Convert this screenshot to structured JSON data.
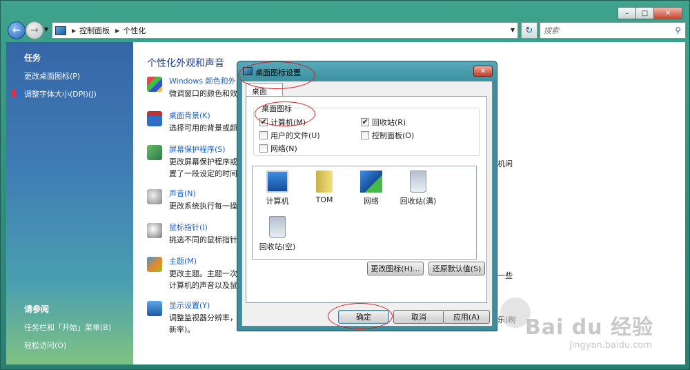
{
  "window": {
    "caption_min": "–",
    "caption_max": "□",
    "caption_close": "✕"
  },
  "navbar": {
    "crumbs": [
      "控制面板",
      "个性化"
    ],
    "search_placeholder": "搜索"
  },
  "left_panel": {
    "tasks_heading": "任务",
    "task_links": [
      "更改桌面图标(P)",
      "调整字体大小(DPI)(J)"
    ],
    "see_also_heading": "请参阅",
    "see_also_links": [
      "任务栏和「开始」菜单(B)",
      "轻松访问(O)"
    ]
  },
  "main": {
    "title": "个性化外观和声音",
    "items": [
      {
        "title": "Windows 颜色和外",
        "desc": "微调窗口的颜色和效"
      },
      {
        "title": "桌面背景(K)",
        "desc": "选择可用的背景或颜"
      },
      {
        "title": "屏幕保护程序(S)",
        "desc": "更改屏幕保护程序或",
        "desc2": "置了一段设定的时间"
      },
      {
        "title": "声音(N)",
        "desc": "更改系统执行每一操"
      },
      {
        "title": "鼠标指针(I)",
        "desc": "挑选不同的鼠标指针"
      },
      {
        "title": "主题(M)",
        "desc": "更改主题。主题一次",
        "desc2": "计算机的声音以及鼠"
      },
      {
        "title": "显示设置(Y)",
        "desc": "调整监视器分辨率，",
        "desc2": "新率)。"
      }
    ],
    "right_fragments": [
      "机闲",
      "一些",
      "乐(刷"
    ]
  },
  "dialog": {
    "title": "桌面图标设置",
    "close": "✕",
    "tab": "桌面",
    "group_label": "桌面图标",
    "checkboxes": [
      {
        "label": "计算机(M)",
        "checked": "✔"
      },
      {
        "label": "回收站(R)",
        "checked": "✔"
      },
      {
        "label": "用户的文件(U)",
        "checked": ""
      },
      {
        "label": "控制面板(O)",
        "checked": ""
      },
      {
        "label": "网络(N)",
        "checked": ""
      }
    ],
    "icons": [
      "计算机",
      "TOM",
      "网络",
      "回收站(满)",
      "回收站(空)"
    ],
    "change_icon_button": "更改图标(H)...",
    "restore_default_button": "还原默认值(S)",
    "ok_button": "确定",
    "cancel_button": "取消",
    "apply_button": "应用(A)"
  },
  "watermark": {
    "brand": "Bai du 经验",
    "url": "jingyan.baidu.com"
  },
  "colors": {
    "annotation": "#d21f1f",
    "link_blue": "#1d5fc7"
  }
}
